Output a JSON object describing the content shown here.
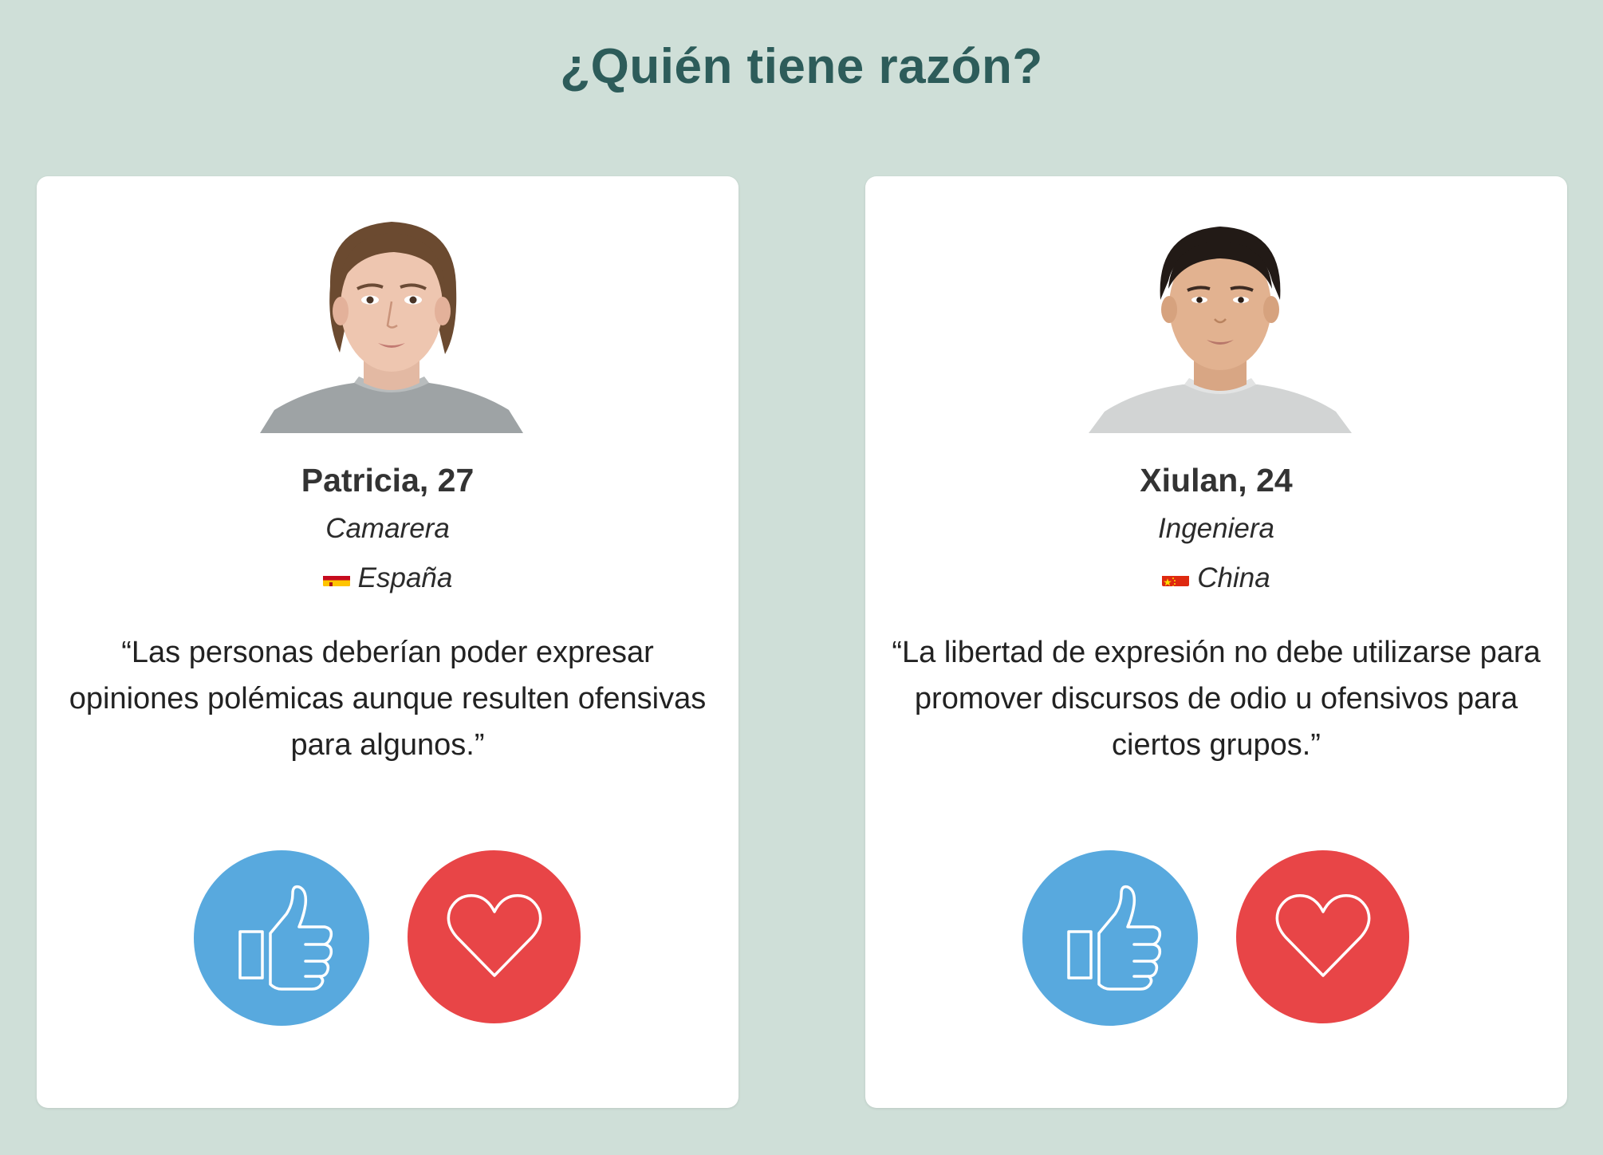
{
  "page": {
    "title": "¿Quién tiene razón?"
  },
  "colors": {
    "background": "#cfdfd8",
    "title": "#2d5c5a",
    "like_button": "#58a9de",
    "love_button": "#e84547",
    "card": "#ffffff"
  },
  "cards": [
    {
      "name": "Patricia, 27",
      "occupation": "Camarera",
      "country": "España",
      "flag_icon": "spain-flag-icon",
      "quote": "“Las personas deberían poder expresar opiniones polémicas aunque resulten ofensivas para algunos.”",
      "like_icon": "thumbs-up-icon",
      "love_icon": "heart-icon"
    },
    {
      "name": "Xiulan, 24",
      "occupation": "Ingeniera",
      "country": "China",
      "flag_icon": "china-flag-icon",
      "quote": "“La libertad de expresión no debe utilizarse para promover discursos de odio u ofensivos para ciertos grupos.”",
      "like_icon": "thumbs-up-icon",
      "love_icon": "heart-icon"
    }
  ]
}
